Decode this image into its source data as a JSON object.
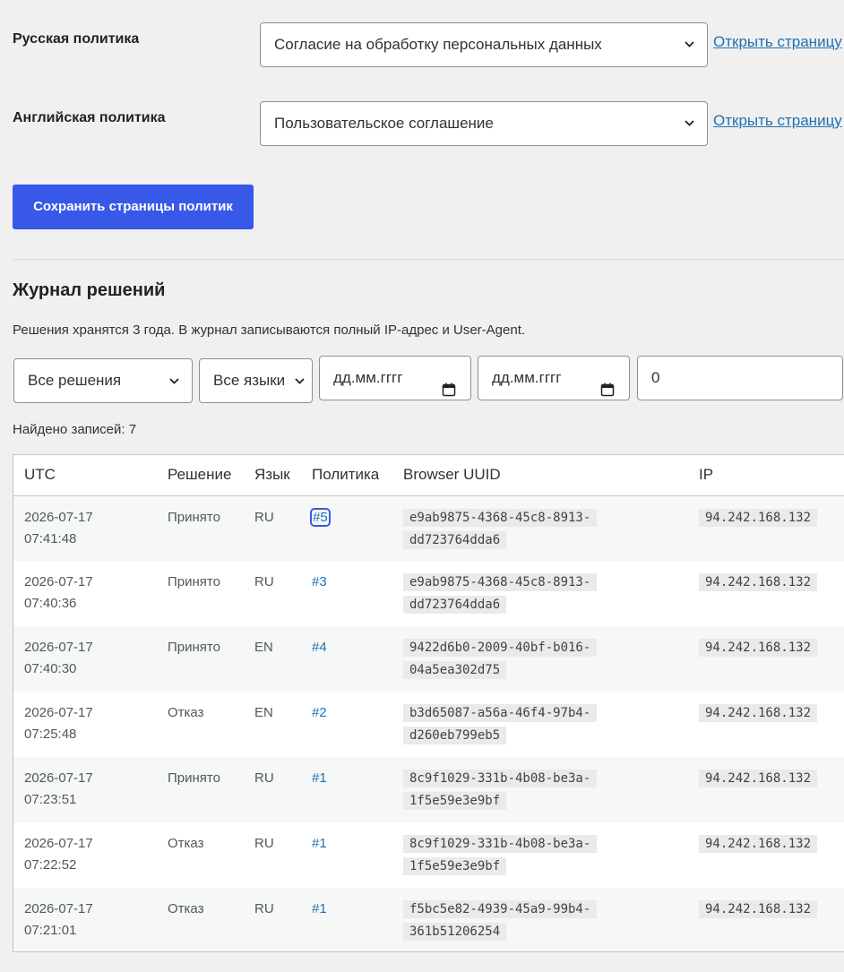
{
  "policies": {
    "ru": {
      "label": "Русская политика",
      "selected": "Согласие на обработку персональных данных",
      "link": "Открыть страницу"
    },
    "en": {
      "label": "Английская политика",
      "selected": "Пользовательское соглашение",
      "link": "Открыть страницу"
    },
    "save_label": "Сохранить страницы политик"
  },
  "journal": {
    "title": "Журнал решений",
    "description": "Решения хранятся 3 года. В журнал записываются полный IP-адрес и User-Agent.",
    "filters": {
      "decision": "Все решения",
      "language": "Все языки",
      "date_from_placeholder": "дд.мм.гггг",
      "date_to_placeholder": "дд.мм.гггг",
      "search_value": "0"
    },
    "found": "Найдено записей: 7",
    "columns": [
      "UTC",
      "Решение",
      "Язык",
      "Политика",
      "Browser UUID",
      "IP"
    ],
    "rows": [
      {
        "date": "2026-07-17",
        "time": "07:41:48",
        "decision": "Принято",
        "lang": "RU",
        "policy": "#5",
        "uuid": "e9ab9875-4368-45c8-8913-dd723764dda6",
        "ip": "94.242.168.132"
      },
      {
        "date": "2026-07-17",
        "time": "07:40:36",
        "decision": "Принято",
        "lang": "RU",
        "policy": "#3",
        "uuid": "e9ab9875-4368-45c8-8913-dd723764dda6",
        "ip": "94.242.168.132"
      },
      {
        "date": "2026-07-17",
        "time": "07:40:30",
        "decision": "Принято",
        "lang": "EN",
        "policy": "#4",
        "uuid": "9422d6b0-2009-40bf-b016-04a5ea302d75",
        "ip": "94.242.168.132"
      },
      {
        "date": "2026-07-17",
        "time": "07:25:48",
        "decision": "Отказ",
        "lang": "EN",
        "policy": "#2",
        "uuid": "b3d65087-a56a-46f4-97b4-d260eb799eb5",
        "ip": "94.242.168.132"
      },
      {
        "date": "2026-07-17",
        "time": "07:23:51",
        "decision": "Принято",
        "lang": "RU",
        "policy": "#1",
        "uuid": "8c9f1029-331b-4b08-be3a-1f5e59e3e9bf",
        "ip": "94.242.168.132"
      },
      {
        "date": "2026-07-17",
        "time": "07:22:52",
        "decision": "Отказ",
        "lang": "RU",
        "policy": "#1",
        "uuid": "8c9f1029-331b-4b08-be3a-1f5e59e3e9bf",
        "ip": "94.242.168.132"
      },
      {
        "date": "2026-07-17",
        "time": "07:21:01",
        "decision": "Отказ",
        "lang": "RU",
        "policy": "#1",
        "uuid": "f5bc5e82-4939-45a9-99b4-361b51206254",
        "ip": "94.242.168.132"
      }
    ]
  },
  "colors": {
    "accent": "#3858e9",
    "link": "#2271b1",
    "page_bg": "#f0f0f1"
  }
}
